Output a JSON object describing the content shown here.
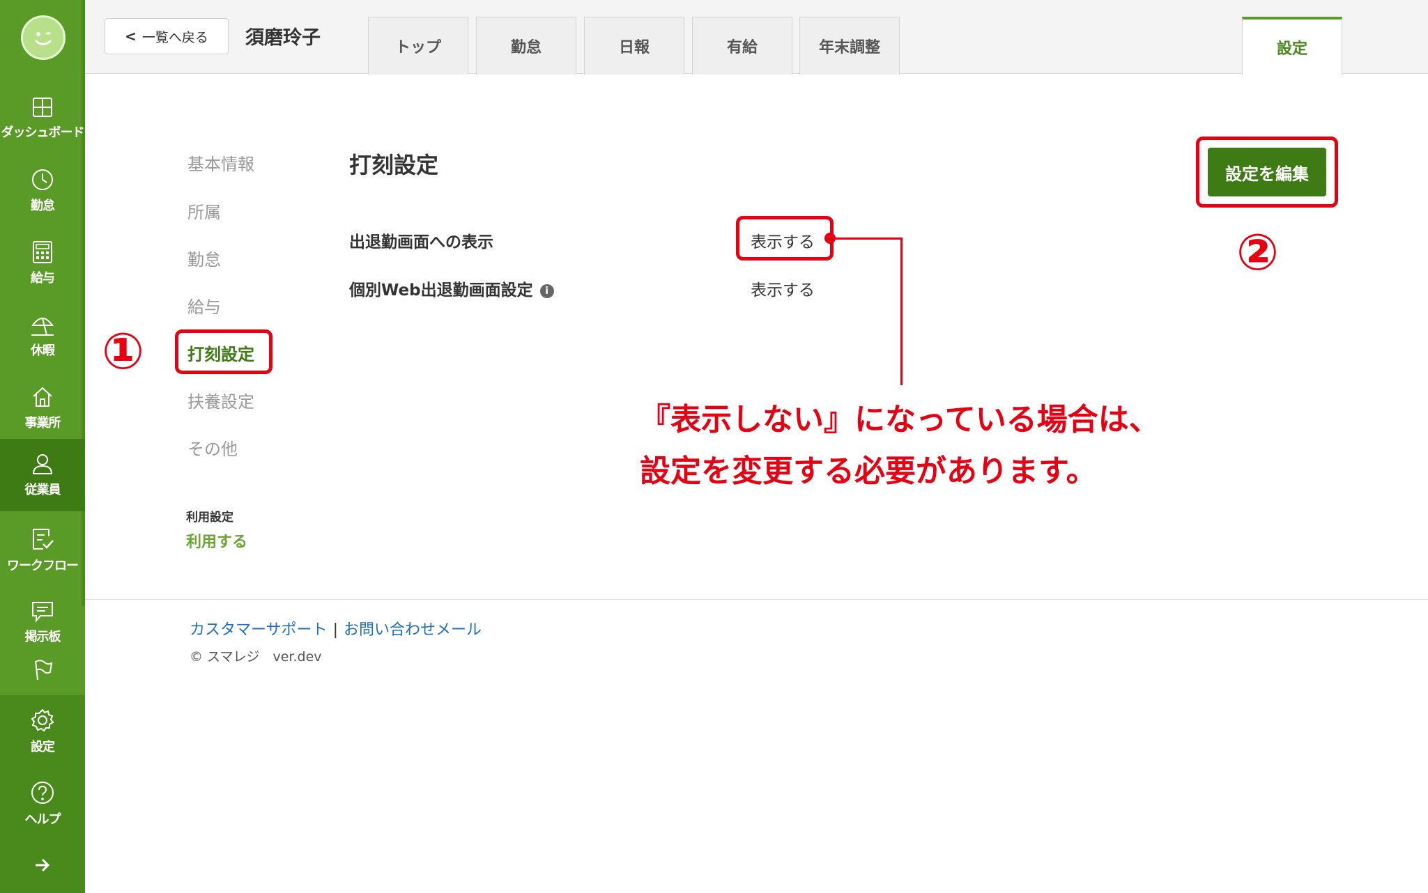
{
  "sidebar": {
    "logo_icon": "smiley-icon",
    "items": [
      {
        "label": "ダッシュボード",
        "icon": "dashboard-icon"
      },
      {
        "label": "勤怠",
        "icon": "clock-icon"
      },
      {
        "label": "給与",
        "icon": "calculator-icon"
      },
      {
        "label": "休暇",
        "icon": "umbrella-icon"
      },
      {
        "label": "事業所",
        "icon": "home-icon"
      },
      {
        "label": "従業員",
        "icon": "person-icon"
      },
      {
        "label": "ワークフロー",
        "icon": "checklist-icon"
      },
      {
        "label": "掲示板",
        "icon": "chat-icon"
      },
      {
        "label": "",
        "icon": "flag-icon"
      }
    ],
    "bottom_items": [
      {
        "label": "設定",
        "icon": "gear-icon"
      },
      {
        "label": "ヘルプ",
        "icon": "help-icon"
      }
    ],
    "expand_icon": "arrow-right-icon",
    "active_item": "従業員",
    "color": "#5a9a26"
  },
  "header": {
    "back_label": "一覧へ戻る",
    "employee_name": "須磨玲子",
    "tabs": [
      "トップ",
      "勤怠",
      "日報",
      "有給",
      "年末調整"
    ],
    "settings_tab": "設定"
  },
  "submenu": {
    "items": [
      "基本情報",
      "所属",
      "勤怠",
      "給与",
      "打刻設定",
      "扶養設定",
      "その他"
    ],
    "active": "打刻設定",
    "usage_label": "利用設定",
    "usage_value": "利用する"
  },
  "main": {
    "title": "打刻設定",
    "rows": [
      {
        "label": "出退勤画面への表示",
        "value": "表示する"
      },
      {
        "label": "個別Web出退勤画面設定",
        "value": "表示する"
      }
    ],
    "info_icon": "i",
    "edit_button": "設定を編集"
  },
  "footer": {
    "support_link": "カスタマーサポート",
    "separator": "|",
    "contact_link": "お問い合わせメール",
    "copyright": "© スマレジ　ver.dev"
  },
  "annotations": {
    "num1": "①",
    "num2": "②",
    "note_line1": "『表示しない』になっている場合は、",
    "note_line2": "設定を変更する必要があります。",
    "color": "#e60012"
  }
}
